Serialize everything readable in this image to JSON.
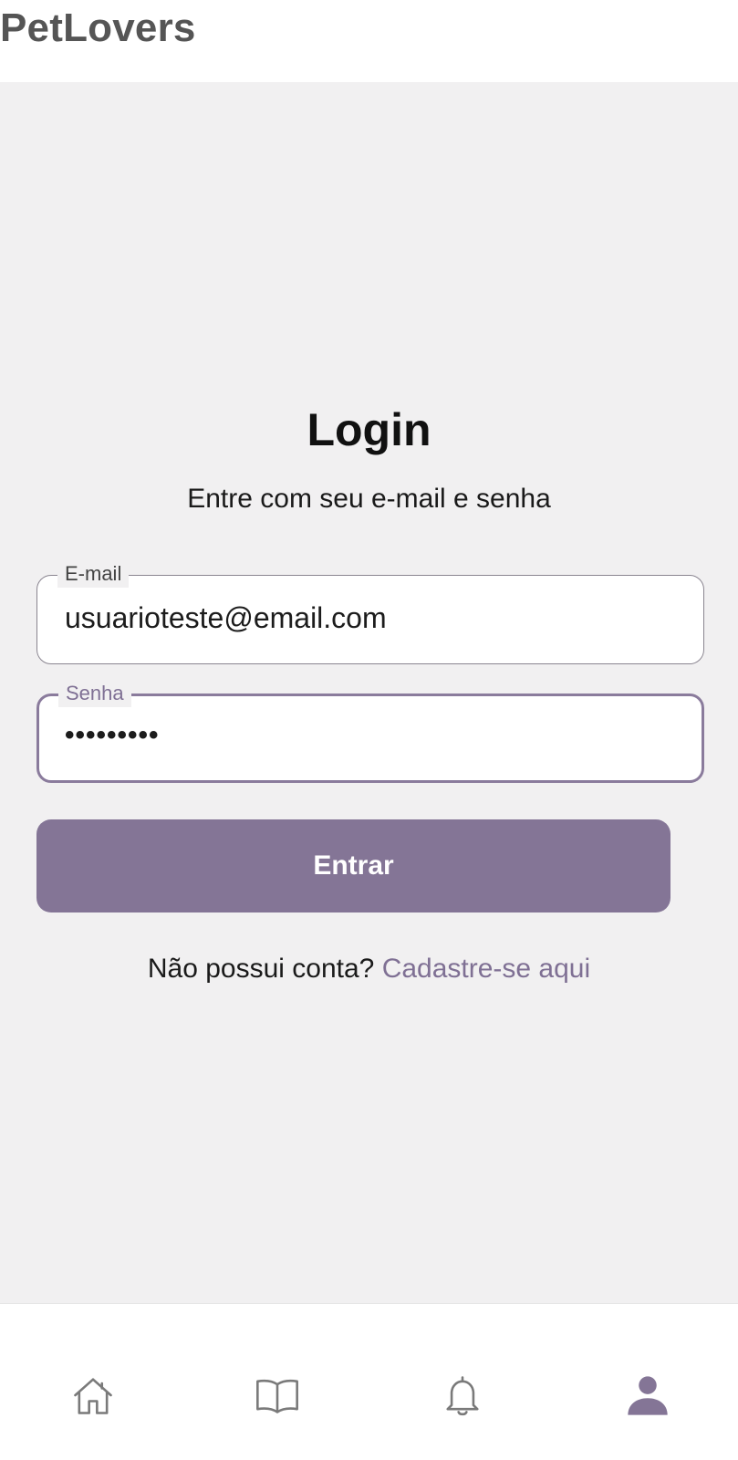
{
  "header": {
    "app_title": "PetLovers"
  },
  "login": {
    "title": "Login",
    "subtitle": "Entre com seu e-mail e senha",
    "email": {
      "label": "E-mail",
      "value": "usuarioteste@email.com"
    },
    "password": {
      "label": "Senha",
      "masked_value": "•••••••••",
      "focused": true
    },
    "submit_label": "Entrar",
    "signup_prompt": "Não possui conta?",
    "signup_link": "Cadastre-se aqui"
  },
  "bottom_nav": {
    "items": [
      {
        "icon": "home-icon",
        "active": false
      },
      {
        "icon": "book-icon",
        "active": false
      },
      {
        "icon": "bell-icon",
        "active": false
      },
      {
        "icon": "profile-icon",
        "active": true
      }
    ]
  },
  "colors": {
    "accent": "#847596",
    "accent_text": "#7f7094",
    "background": "#f1f0f1",
    "title_gray": "#555555"
  }
}
